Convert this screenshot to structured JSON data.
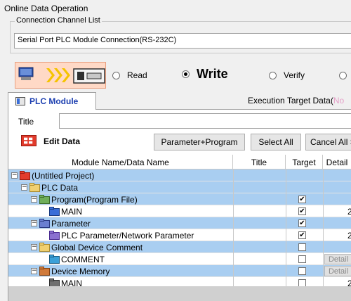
{
  "window": {
    "title": "Online Data Operation"
  },
  "connection": {
    "legend": "Connection Channel List",
    "value": "Serial Port  PLC Module Connection(RS-232C)"
  },
  "mode": {
    "options": [
      {
        "label": "Read",
        "selected": false
      },
      {
        "label": "Write",
        "selected": true
      },
      {
        "label": "Verify",
        "selected": false
      },
      {
        "label": "",
        "selected": false
      }
    ]
  },
  "tab": {
    "label": "PLC Module"
  },
  "execution_target": {
    "label": "Execution Target Data(",
    "value": "No"
  },
  "title_field": {
    "label": "Title",
    "value": ""
  },
  "edit_data": {
    "label": "Edit Data"
  },
  "buttons": {
    "param_program": "Parameter+Program",
    "select_all": "Select All",
    "cancel_all": "Cancel All Selections"
  },
  "grid": {
    "headers": {
      "name": "Module Name/Data Name",
      "title": "Title",
      "target": "Target",
      "detail": "Detail"
    },
    "detail_label": "Detail",
    "rows": [
      {
        "name": "(Untitled Project)",
        "level": 0,
        "expander": "−",
        "icon": "project-icon",
        "style": "blue",
        "target": null,
        "detail": false,
        "extra": ""
      },
      {
        "name": "PLC Data",
        "level": 1,
        "expander": "−",
        "icon": "folder-icon",
        "style": "blue",
        "target": null,
        "detail": false,
        "extra": ""
      },
      {
        "name": "Program(Program File)",
        "level": 2,
        "expander": "−",
        "icon": "program-folder-icon",
        "style": "blue",
        "target": true,
        "detail": false,
        "extra": ""
      },
      {
        "name": "MAIN",
        "level": 3,
        "expander": "",
        "icon": "program-icon",
        "style": "white",
        "target": true,
        "detail": false,
        "extra": "2"
      },
      {
        "name": "Parameter",
        "level": 2,
        "expander": "−",
        "icon": "parameter-folder-icon",
        "style": "blue",
        "target": true,
        "detail": false,
        "extra": ""
      },
      {
        "name": "PLC Parameter/Network Parameter",
        "level": 3,
        "expander": "",
        "icon": "parameter-icon",
        "style": "white",
        "target": true,
        "detail": false,
        "extra": "2"
      },
      {
        "name": "Global Device Comment",
        "level": 2,
        "expander": "−",
        "icon": "comment-folder-icon",
        "style": "blue",
        "target": false,
        "detail": false,
        "extra": ""
      },
      {
        "name": "COMMENT",
        "level": 3,
        "expander": "",
        "icon": "comment-icon",
        "style": "white",
        "target": false,
        "detail": true,
        "extra": ""
      },
      {
        "name": "Device Memory",
        "level": 2,
        "expander": "−",
        "icon": "device-memory-folder-icon",
        "style": "blue",
        "target": false,
        "detail": true,
        "extra": ""
      },
      {
        "name": "MAIN",
        "level": 3,
        "expander": "",
        "icon": "device-memory-icon",
        "style": "white",
        "target": false,
        "detail": false,
        "extra": "2"
      }
    ]
  }
}
